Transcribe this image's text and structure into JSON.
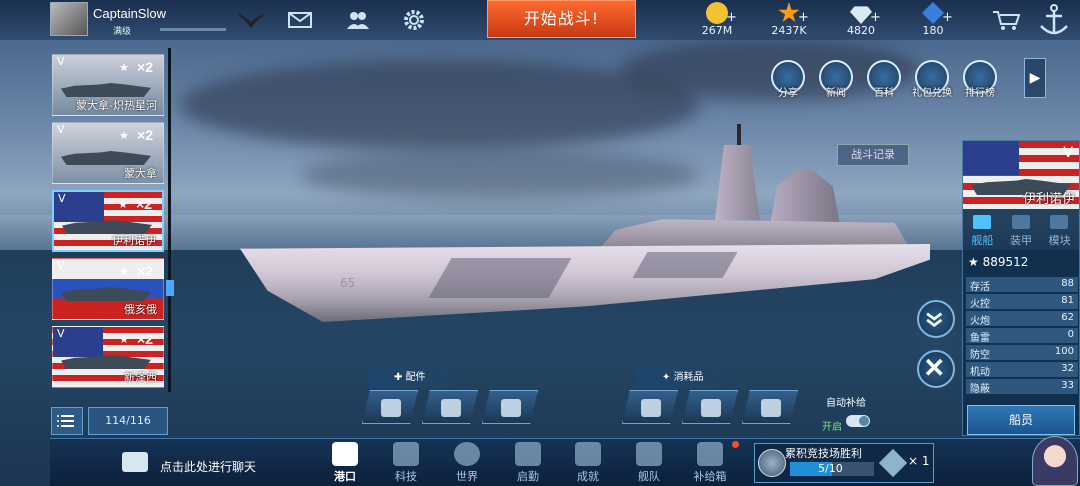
{
  "player": {
    "name": "CaptainSlow",
    "level": "满级"
  },
  "topbar": {
    "start_battle": "开始战斗!"
  },
  "resources": [
    {
      "name": "gold",
      "value": "267M",
      "color": "#f1c232"
    },
    {
      "name": "stars",
      "value": "2437K",
      "color": "#ff9b1a"
    },
    {
      "name": "diamonds",
      "value": "4820",
      "color": "#d8e8f4"
    },
    {
      "name": "gems",
      "value": "180",
      "color": "#3a7ee0"
    }
  ],
  "quick_menu": [
    {
      "label": "分享",
      "icon": "share-icon"
    },
    {
      "label": "新闻",
      "icon": "news-icon"
    },
    {
      "label": "百科",
      "icon": "encyclopedia-icon"
    },
    {
      "label": "礼包兑换",
      "icon": "gift-exchange-icon"
    },
    {
      "label": "排行榜",
      "icon": "leaderboard-icon"
    }
  ],
  "battle_record": "战斗记录",
  "ship_list": [
    {
      "tier": "V",
      "mult": "×2",
      "name": "蒙大拿-炽热星河",
      "flag": "plain"
    },
    {
      "tier": "V",
      "mult": "×2",
      "name": "蒙大拿",
      "flag": "plain"
    },
    {
      "tier": "V",
      "mult": "×2",
      "name": "伊利诺伊",
      "flag": "usa",
      "selected": true
    },
    {
      "tier": "V",
      "mult": "×2",
      "name": "俄亥俄",
      "flag": "usa"
    },
    {
      "tier": "V",
      "mult": "×2",
      "name": "新泽西",
      "flag": "usa"
    }
  ],
  "list_count": "114/116",
  "hull_number": "65",
  "ship_panel": {
    "tier": "V",
    "name": "伊利诺伊",
    "tabs": [
      "舰船",
      "装甲",
      "模块"
    ],
    "rating": "889512",
    "stats": [
      {
        "label": "存活",
        "value": "88"
      },
      {
        "label": "火控",
        "value": "81"
      },
      {
        "label": "火炮",
        "value": "62"
      },
      {
        "label": "鱼雷",
        "value": "0"
      },
      {
        "label": "防空",
        "value": "100"
      },
      {
        "label": "机动",
        "value": "32"
      },
      {
        "label": "隐蔽",
        "value": "33"
      }
    ],
    "crew_button": "船员"
  },
  "loadout": {
    "parts_title": "配件",
    "consumables_title": "消耗品",
    "auto_supply": "自动补给",
    "auto_supply_state": "开启"
  },
  "bottom": {
    "chat": "点击此处进行聊天",
    "nav": [
      {
        "label": "港口",
        "icon": "harbor-icon",
        "active": true
      },
      {
        "label": "科技",
        "icon": "tech-icon"
      },
      {
        "label": "世界",
        "icon": "globe-icon"
      },
      {
        "label": "启勤",
        "icon": "duty-icon"
      },
      {
        "label": "成就",
        "icon": "achievement-icon"
      },
      {
        "label": "舰队",
        "icon": "fleet-icon"
      },
      {
        "label": "补给箱",
        "icon": "supply-box-icon"
      }
    ],
    "arena": {
      "title": "累积竞技场胜利",
      "progress": "5/10",
      "progress_fraction": 0.5,
      "reward_count": "× 1"
    }
  }
}
